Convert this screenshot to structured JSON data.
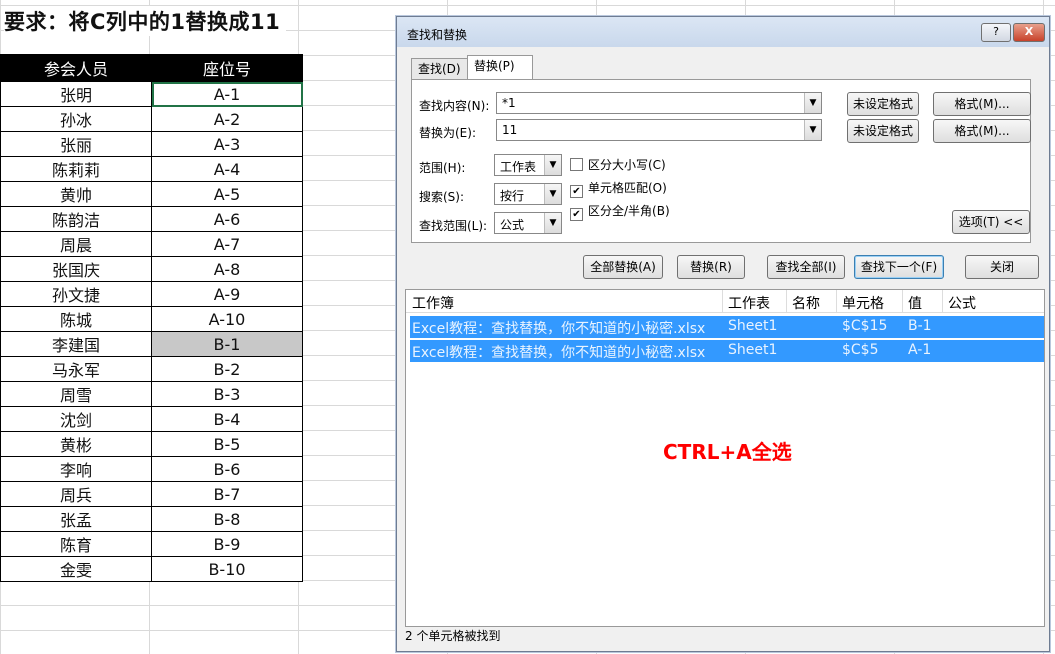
{
  "requirement": "要求：将C列中的1替换成11",
  "table": {
    "headers": [
      "参会人员",
      "座位号"
    ],
    "rows": [
      [
        "张明",
        "A-1"
      ],
      [
        "孙冰",
        "A-2"
      ],
      [
        "张丽",
        "A-3"
      ],
      [
        "陈莉莉",
        "A-4"
      ],
      [
        "黄帅",
        "A-5"
      ],
      [
        "陈韵洁",
        "A-6"
      ],
      [
        "周晨",
        "A-7"
      ],
      [
        "张国庆",
        "A-8"
      ],
      [
        "孙文捷",
        "A-9"
      ],
      [
        "陈城",
        "A-10"
      ],
      [
        "李建国",
        "B-1"
      ],
      [
        "马永军",
        "B-2"
      ],
      [
        "周雪",
        "B-3"
      ],
      [
        "沈剑",
        "B-4"
      ],
      [
        "黄彬",
        "B-5"
      ],
      [
        "李响",
        "B-6"
      ],
      [
        "周兵",
        "B-7"
      ],
      [
        "张孟",
        "B-8"
      ],
      [
        "陈育",
        "B-9"
      ],
      [
        "金雯",
        "B-10"
      ]
    ]
  },
  "dialog": {
    "title": "查找和替换",
    "help": "?",
    "close": "X",
    "tabs": [
      "查找(D)",
      "替换(P)"
    ],
    "find_label": "查找内容(N):",
    "find_value": "*1",
    "replace_label": "替换为(E):",
    "replace_value": "11",
    "no_format": "未设定格式",
    "format_btn": "格式(M)...",
    "scope_label": "范围(H):",
    "scope_value": "工作表",
    "search_label": "搜索(S):",
    "search_value": "按行",
    "lookin_label": "查找范围(L):",
    "lookin_value": "公式",
    "opt_case": "区分大小写(C)",
    "opt_cell": "单元格匹配(O)",
    "opt_width": "区分全/半角(B)",
    "options_btn": "选项(T) <<",
    "btn_replace_all": "全部替换(A)",
    "btn_replace": "替换(R)",
    "btn_find_all": "查找全部(I)",
    "btn_find_next": "查找下一个(F)",
    "btn_close": "关闭",
    "result_headers": [
      "工作簿",
      "工作表",
      "名称",
      "单元格",
      "值",
      "公式"
    ],
    "results": [
      {
        "book": "Excel教程：查找替换，你不知道的小秘密.xlsx",
        "sheet": "Sheet1",
        "name": "",
        "cell": "$C$15",
        "value": "B-1"
      },
      {
        "book": "Excel教程：查找替换，你不知道的小秘密.xlsx",
        "sheet": "Sheet1",
        "name": "",
        "cell": "$C$5",
        "value": "A-1"
      }
    ],
    "annotation": "CTRL+A全选",
    "status": "2 个单元格被找到"
  }
}
